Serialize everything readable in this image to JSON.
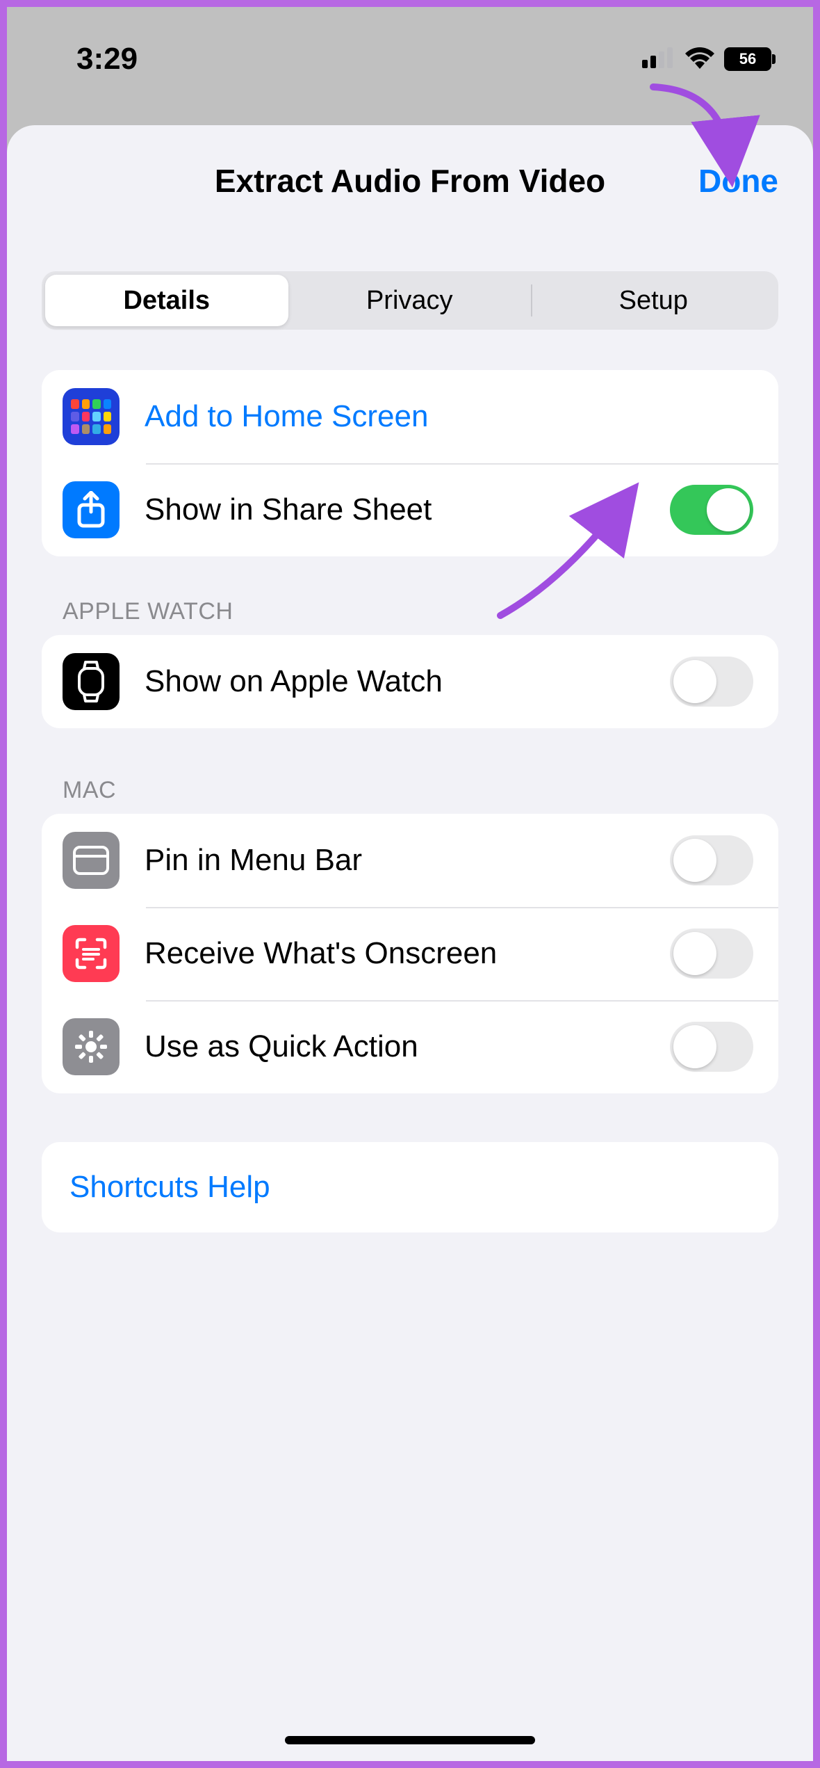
{
  "status_bar": {
    "time": "3:29",
    "battery_percent": "56"
  },
  "nav": {
    "title": "Extract Audio From Video",
    "done": "Done"
  },
  "tabs": {
    "details": "Details",
    "privacy": "Privacy",
    "setup": "Setup"
  },
  "group_general": {
    "add_home": "Add to Home Screen",
    "share_sheet": "Show in Share Sheet"
  },
  "group_watch": {
    "header": "APPLE WATCH",
    "show_watch": "Show on Apple Watch"
  },
  "group_mac": {
    "header": "MAC",
    "pin_menu": "Pin in Menu Bar",
    "receive": "Receive What's Onscreen",
    "quick_action": "Use as Quick Action"
  },
  "help": {
    "label": "Shortcuts Help"
  },
  "toggles": {
    "share_sheet": true,
    "apple_watch": false,
    "pin_menu": false,
    "receive": false,
    "quick_action": false
  },
  "colors": {
    "link": "#007aff",
    "toggle_on": "#34c759",
    "annotation": "#a04de0"
  }
}
